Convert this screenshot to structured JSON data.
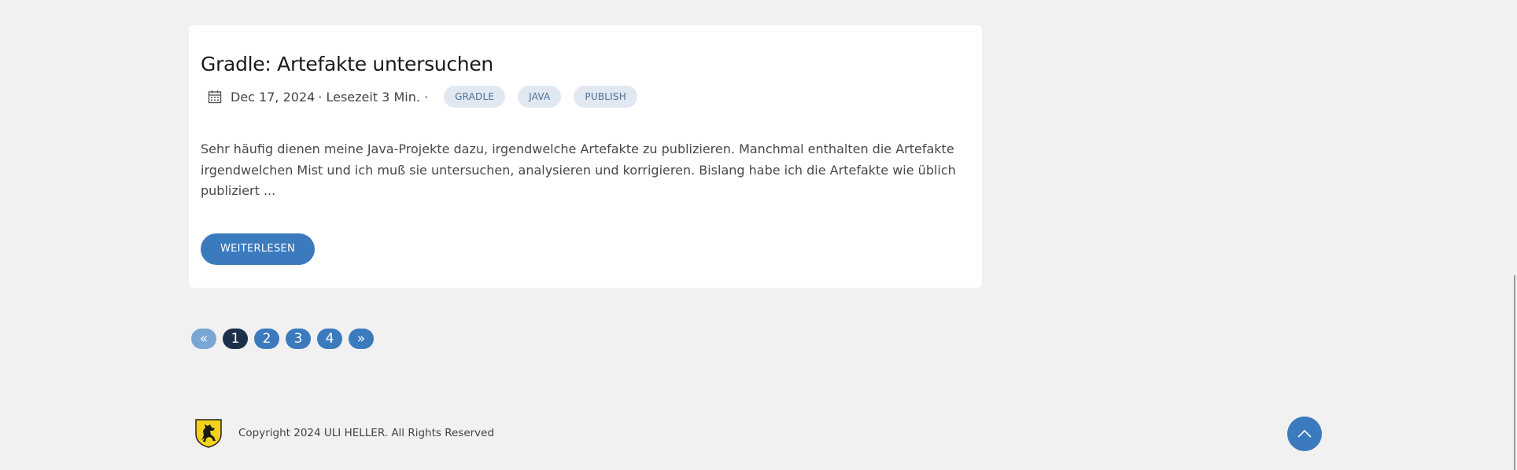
{
  "post": {
    "title": "Gradle: Artefakte untersuchen",
    "date": "Dec 17, 2024",
    "reading_time": "· Lesezeit 3 Min. ·",
    "tags": [
      "GRADLE",
      "JAVA",
      "PUBLISH"
    ],
    "excerpt": "Sehr häufig dienen meine Java-Projekte dazu, irgendwelche Artefakte zu publizieren. Manchmal enthalten die Artefakte irgendwelchen Mist und ich muß sie untersuchen, analysieren und korrigieren. Bislang habe ich die Artefakte wie üblich publiziert ...",
    "read_more_label": "WEITERLESEN"
  },
  "pagination": {
    "prev": "«",
    "pages": [
      "1",
      "2",
      "3",
      "4"
    ],
    "current": "1",
    "next": "»"
  },
  "footer": {
    "copyright": "Copyright 2024 ULI HELLER. All Rights Reserved"
  },
  "icons": {
    "calendar": "calendar-icon",
    "logo": "stuttgart-crest-logo",
    "to_top": "chevron-up-icon"
  },
  "colors": {
    "accent": "#3a7abd",
    "active_page": "#1c3049",
    "tag_bg": "#e1e8f1",
    "tag_text": "#4d6f98",
    "background": "#f1f1f1"
  }
}
